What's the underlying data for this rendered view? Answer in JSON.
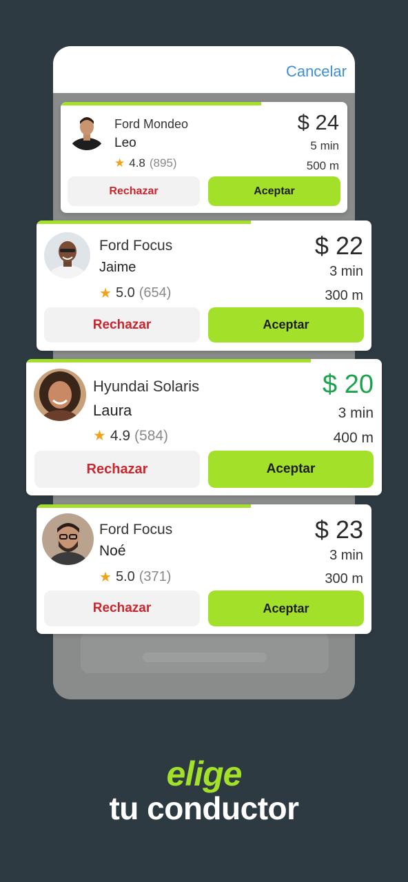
{
  "header": {
    "cancel_label": "Cancelar"
  },
  "offers": [
    {
      "car": "Ford Mondeo",
      "driver": "Leo",
      "rating": "4.8",
      "reviews": "(895)",
      "price": "$ 24",
      "time": "5 min",
      "distance": "500 m",
      "reject_label": "Rechazar",
      "accept_label": "Aceptar",
      "progress": 0.7
    },
    {
      "car": "Ford Focus",
      "driver": "Jaime",
      "rating": "5.0",
      "reviews": "(654)",
      "price": "$ 22",
      "time": "3 min",
      "distance": "300 m",
      "reject_label": "Rechazar",
      "accept_label": "Aceptar",
      "progress": 0.64
    },
    {
      "car": "Hyundai Solaris",
      "driver": "Laura",
      "rating": "4.9",
      "reviews": "(584)",
      "price": "$ 20",
      "time": "3 min",
      "distance": "400 m",
      "reject_label": "Rechazar",
      "accept_label": "Aceptar",
      "progress": 0.8
    },
    {
      "car": "Ford Focus",
      "driver": "Noé",
      "rating": "5.0",
      "reviews": "(371)",
      "price": "$ 23",
      "time": "3 min",
      "distance": "300 m",
      "reject_label": "Rechazar",
      "accept_label": "Aceptar",
      "progress": 0.64
    }
  ],
  "tagline": {
    "line1": "elige",
    "line2": "tu conductor"
  },
  "colors": {
    "accent": "#a3e02a",
    "background": "#2e3a42",
    "best_price": "#1aa34a",
    "reject_text": "#c9262d",
    "link": "#3d8fd6"
  }
}
